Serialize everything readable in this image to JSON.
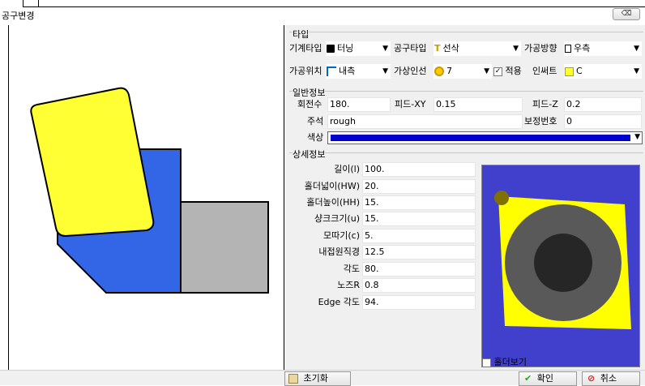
{
  "window": {
    "title": "공구변경",
    "close_label": "⌫"
  },
  "type_section": {
    "label": "타입",
    "machine_type_label": "기계타입",
    "machine_type_value": "터닝",
    "tool_type_label": "공구타입",
    "tool_type_value": "선삭",
    "direction_label": "가공방향",
    "direction_value": "우측",
    "position_label": "가공위치",
    "position_value": "내측",
    "insert_label": "가상인선",
    "insert_value": "7",
    "apply_label": "적용",
    "apply_checked": true,
    "insert_type_label": "인써트",
    "insert_type_value": "C"
  },
  "general": {
    "label": "일반정보",
    "rpm_label": "회전수",
    "rpm_value": "180.",
    "feed_xy_label": "피드-XY",
    "feed_xy_value": "0.15",
    "feed_z_label": "피드-Z",
    "feed_z_value": "0.2",
    "note_label": "주석",
    "note_value": "rough",
    "comp_label": "보정번호",
    "comp_value": "0",
    "color_label": "색상",
    "color_value": "#0000cc"
  },
  "detail": {
    "label": "상세정보",
    "fields": [
      {
        "label": "길이(l)",
        "value": "100."
      },
      {
        "label": "홀더넓이(HW)",
        "value": "20."
      },
      {
        "label": "홀더높이(HH)",
        "value": "15."
      },
      {
        "label": "샹크크기(u)",
        "value": "15."
      },
      {
        "label": "모따기(c)",
        "value": "5."
      },
      {
        "label": "내접원직경",
        "value": "12.5"
      },
      {
        "label": "각도",
        "value": "80."
      },
      {
        "label": "노즈R",
        "value": "0.8"
      },
      {
        "label": "Edge 각도",
        "value": "94."
      }
    ],
    "holder_view_label": "홀더보기"
  },
  "buttons": {
    "reset": "초기화",
    "ok": "확인",
    "cancel": "취소"
  },
  "colors": {
    "insert": "#ffff33",
    "holder": "#3366e6",
    "shank": "#b4b4b4",
    "preview_bg": "#ffff00",
    "preview_frame": "#4040cc"
  }
}
